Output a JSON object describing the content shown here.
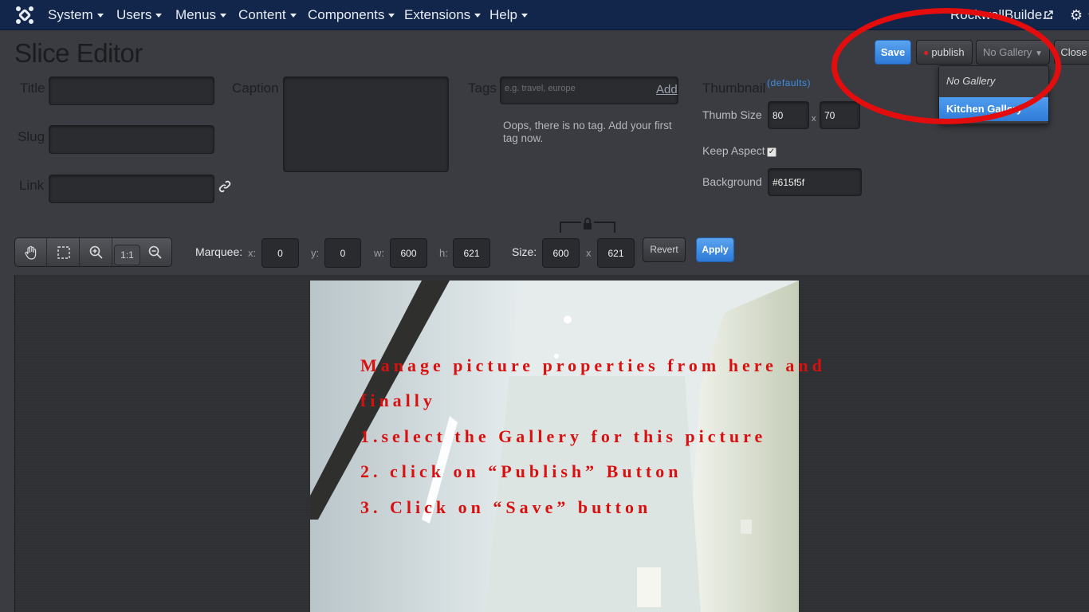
{
  "topnav": {
    "menus": [
      {
        "label": "System"
      },
      {
        "label": "Users"
      },
      {
        "label": "Menus"
      },
      {
        "label": "Content"
      },
      {
        "label": "Components"
      },
      {
        "label": "Extensions"
      },
      {
        "label": "Help"
      }
    ],
    "site_link": "RockwellBuilde..."
  },
  "page_title": "Slice Editor",
  "form": {
    "title_label": "Title",
    "slug_label": "Slug",
    "link_label": "Link",
    "caption_label": "Caption",
    "tags_label": "Tags",
    "tags_placeholder": "e.g. travel, europe",
    "tags_add": "Add",
    "tags_message": "Oops, there is no tag. Add your first tag now.",
    "thumbnail_label": "Thumbnail",
    "defaults_link": "(defaults)",
    "thumb_size_label": "Thumb Size",
    "thumb_width": "80",
    "thumb_height": "70",
    "times": "x",
    "keep_aspect_label": "Keep Aspect",
    "keep_aspect_checked": true,
    "background_label": "Background",
    "background_value": "#615f5f"
  },
  "actions": {
    "save": "Save",
    "publish": "publish",
    "gallery_selected": "No Gallery",
    "close": "Close",
    "gallery_options": [
      "No Gallery",
      "Kitchen Gallery"
    ]
  },
  "toolbar": {
    "one_to_one": "1:1",
    "marquee_label": "Marquee:",
    "x_label": "x:",
    "x": "0",
    "y_label": "y:",
    "y": "0",
    "w_label": "w:",
    "w": "600",
    "h_label": "h:",
    "h": "621",
    "size_label": "Size:",
    "size_w": "600",
    "size_times": "x",
    "size_h": "621",
    "revert": "Revert",
    "apply": "Apply"
  },
  "instructions": [
    "Manage picture properties from here and",
    "finally",
    "1.select the Gallery for this picture",
    "2. click on “Publish” Button",
    "3. Click on “Save” button"
  ],
  "colors": {
    "accent_blue": "#2d79d6",
    "annotation_red": "#e30d0d",
    "navbar": "#11264a"
  }
}
